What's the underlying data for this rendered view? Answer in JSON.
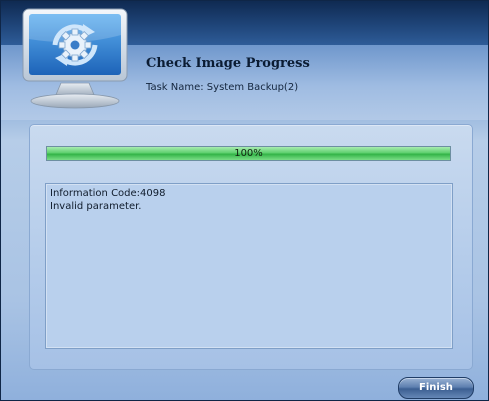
{
  "header": {
    "title": "Check Image Progress",
    "task_label": "Task Name: System Backup(2)"
  },
  "progress": {
    "value_fraction": 1.0,
    "label": "100%"
  },
  "info": {
    "lines": [
      "Information Code:4098",
      "Invalid parameter."
    ]
  },
  "footer": {
    "finish_label": "Finish"
  },
  "colors": {
    "progress_fill": "#33b447",
    "header_band": "#1f4579",
    "panel_bg": "#b3cbea"
  },
  "icons": {
    "logo": "monitor-sync-gear-icon"
  }
}
